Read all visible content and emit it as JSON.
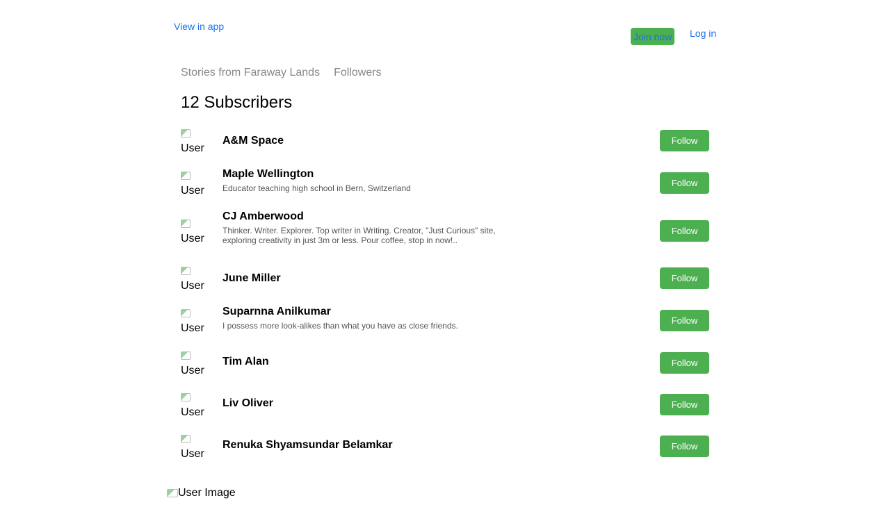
{
  "header": {
    "view_in_app": "View in app",
    "join_now": "Join now",
    "log_in": "Log in"
  },
  "tabs": [
    "Stories from Faraway Lands",
    "Followers"
  ],
  "title": "12 Subscribers",
  "avatar_alt": "User Image",
  "follow_label": "Follow",
  "subscribers": [
    {
      "name": "A&M Space",
      "bio": ""
    },
    {
      "name": "Maple Wellington",
      "bio": "Educator teaching high school in Bern, Switzerland"
    },
    {
      "name": "CJ Amberwood",
      "bio": "Thinker. Writer. Explorer. Top writer in Writing. Creator, \"Just Curious\" site, exploring creativity in just 3m or less. Pour coffee, stop in now!.."
    },
    {
      "name": "June Miller",
      "bio": ""
    },
    {
      "name": "Suparnna Anilkumar",
      "bio": "I possess more look-alikes than what you have as close friends."
    },
    {
      "name": "Tim Alan",
      "bio": ""
    },
    {
      "name": "Liv Oliver",
      "bio": ""
    },
    {
      "name": "Renuka Shyamsundar Belamkar",
      "bio": ""
    }
  ],
  "footer_image_alt": "User Image",
  "colors": {
    "accent_green": "#4caf50",
    "link_blue": "#1a73e8",
    "muted": "#888888"
  }
}
